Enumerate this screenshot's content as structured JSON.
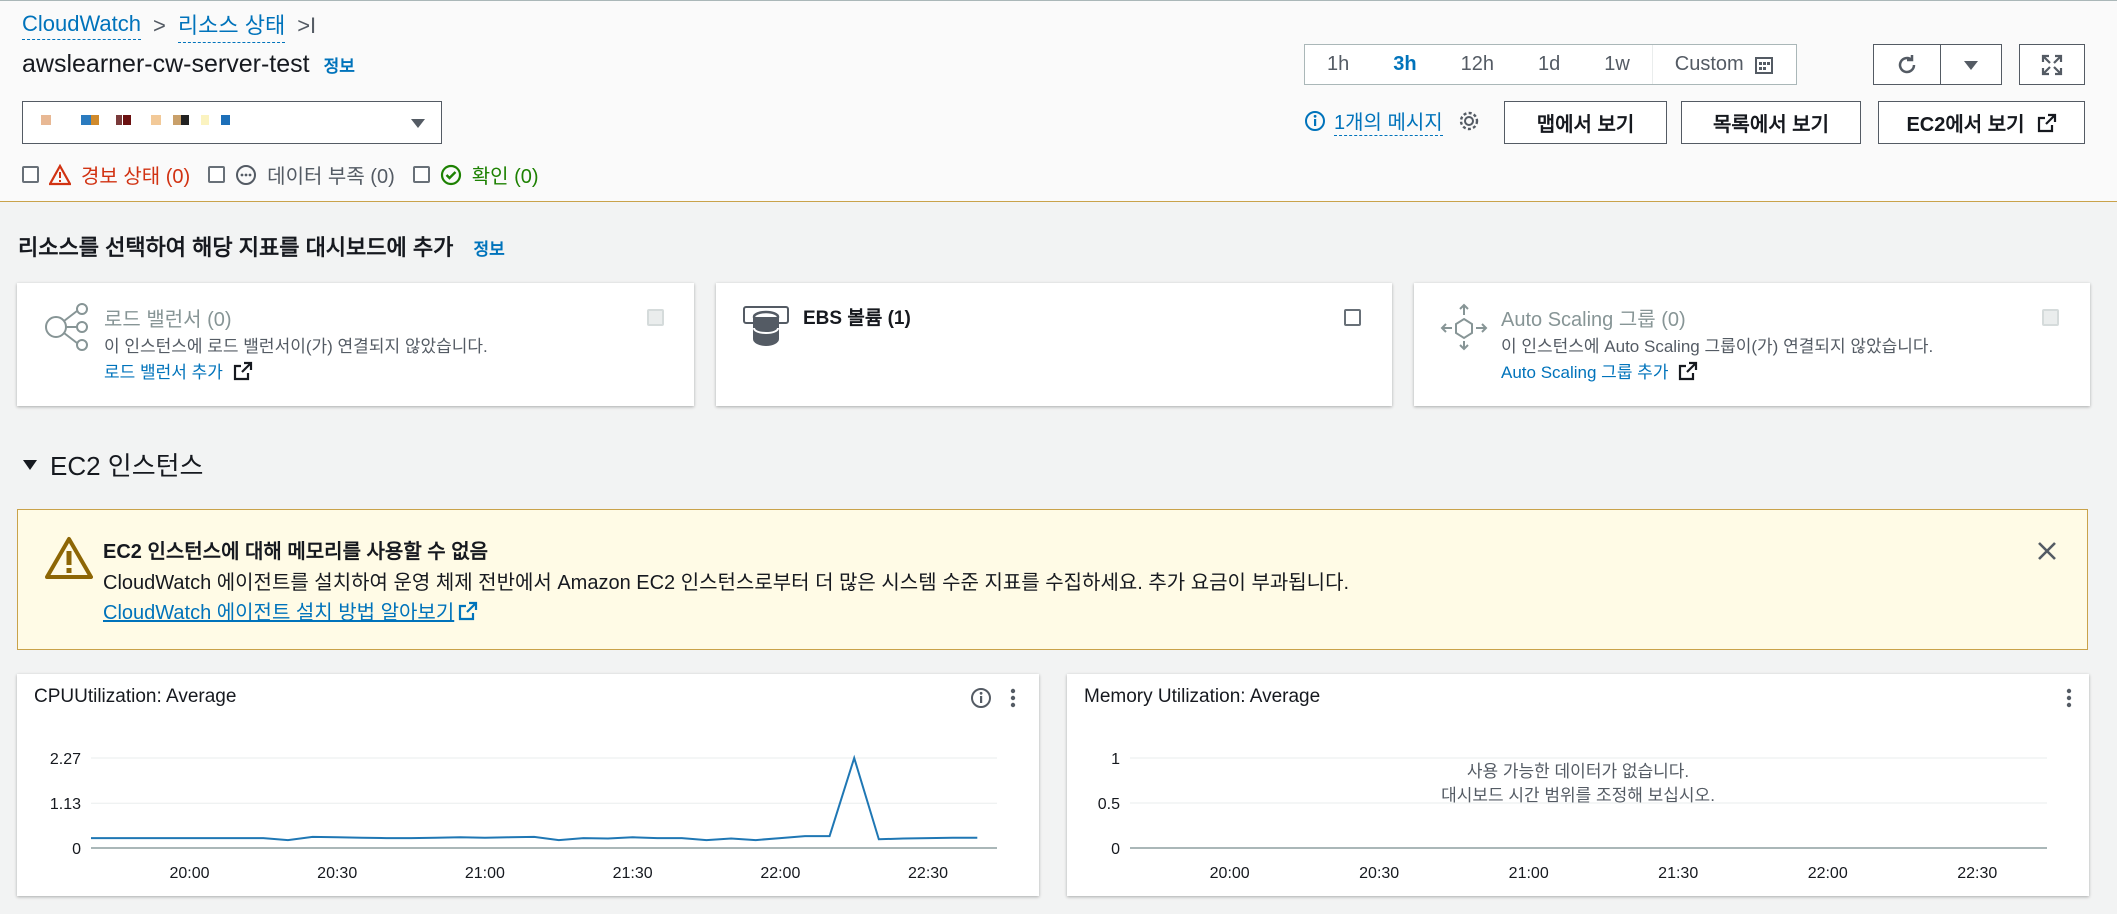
{
  "breadcrumb": {
    "root": "CloudWatch",
    "current": "리소스 상태",
    "tail": ">I"
  },
  "page": {
    "title": "awslearner-cw-server-test",
    "info": "정보"
  },
  "time_range": {
    "options": [
      "1h",
      "3h",
      "12h",
      "1d",
      "1w"
    ],
    "selected": "3h",
    "custom_label": "Custom"
  },
  "messages": {
    "label": "1개의 메시지"
  },
  "buttons": {
    "map_view": "맵에서 보기",
    "list_view": "목록에서 보기",
    "ec2_view": "EC2에서 보기"
  },
  "filters": {
    "alarm": "경보 상태 (0)",
    "insufficient": "데이터 부족 (0)",
    "ok": "확인 (0)",
    "alarm_color": "#d13212",
    "ok_color": "#1d8102"
  },
  "add_section": {
    "title": "리소스를 선택하여 해당 지표를 대시보드에 추가",
    "info": "정보"
  },
  "cards": [
    {
      "title": "로드 밸런서 (0)",
      "desc": "이 인스턴스에 로드 밸런서이(가) 연결되지 않았습니다.",
      "link": "로드 밸런서 추가"
    },
    {
      "title": "EBS 볼륨 (1)"
    },
    {
      "title": "Auto Scaling 그룹 (0)",
      "desc": "이 인스턴스에 Auto Scaling 그룹이(가) 연결되지 않았습니다.",
      "link": "Auto Scaling 그룹 추가"
    }
  ],
  "ec2_section": {
    "title": "EC2 인스턴스"
  },
  "banner": {
    "title": "EC2 인스턴스에 대해 메모리를 사용할 수 없음",
    "body": "CloudWatch 에이전트를 설치하여 운영 체제 전반에서 Amazon EC2 인스턴스로부터 더 많은 시스템 수준 지표를 수집하세요. 추가 요금이 부과됩니다.",
    "link": "CloudWatch 에이전트 설치 방법 알아보기"
  },
  "charts": {
    "cpu_title": "CPUUtilization: Average",
    "mem_title": "Memory Utilization: Average",
    "no_data_line1": "사용 가능한 데이터가 없습니다.",
    "no_data_line2": "대시보드 시간 범위를 조정해 보십시오."
  },
  "chart_data": [
    {
      "type": "line",
      "title": "CPUUtilization: Average",
      "x_ticks": [
        "20:00",
        "20:30",
        "21:00",
        "21:30",
        "22:00",
        "22:30"
      ],
      "y_ticks": [
        "2.27",
        "1.13",
        "0"
      ],
      "ylim": [
        0,
        2.27
      ],
      "xlim": [
        "19:40",
        "22:45"
      ],
      "series": [
        {
          "x": [
            "19:40",
            "19:45",
            "19:50",
            "19:55",
            "20:00",
            "20:05",
            "20:10",
            "20:15",
            "20:20",
            "20:25",
            "20:30",
            "20:35",
            "20:40",
            "20:45",
            "20:50",
            "20:55",
            "21:00",
            "21:05",
            "21:10",
            "21:15",
            "21:20",
            "21:25",
            "21:30",
            "21:35",
            "21:40",
            "21:45",
            "21:50",
            "21:55",
            "22:00",
            "22:05",
            "22:10",
            "22:15",
            "22:20",
            "22:25",
            "22:30",
            "22:35",
            "22:40"
          ],
          "values": [
            0.25,
            0.25,
            0.25,
            0.25,
            0.25,
            0.25,
            0.25,
            0.25,
            0.2,
            0.28,
            0.27,
            0.26,
            0.25,
            0.25,
            0.26,
            0.27,
            0.26,
            0.27,
            0.28,
            0.2,
            0.25,
            0.24,
            0.27,
            0.25,
            0.25,
            0.2,
            0.24,
            0.2,
            0.25,
            0.3,
            0.3,
            2.27,
            0.22,
            0.24,
            0.25,
            0.26,
            0.26
          ],
          "color": "#1f77b4"
        }
      ]
    },
    {
      "type": "line",
      "title": "Memory Utilization: Average",
      "x_ticks": [
        "20:00",
        "20:30",
        "21:00",
        "21:30",
        "22:00",
        "22:30"
      ],
      "y_ticks": [
        "1",
        "0.5",
        "0"
      ],
      "ylim": [
        0,
        1
      ],
      "series": []
    }
  ]
}
